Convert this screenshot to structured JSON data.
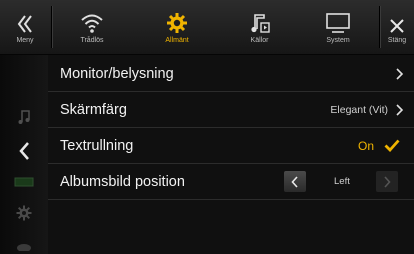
{
  "topbar": {
    "menu_label": "Meny",
    "tabs": [
      {
        "label": "Trådlös",
        "icon": "wifi-icon"
      },
      {
        "label": "Allmänt",
        "icon": "gear-icon"
      },
      {
        "label": "Källor",
        "icon": "music-note-icon"
      },
      {
        "label": "System",
        "icon": "monitor-icon"
      }
    ],
    "close_label": "Stäng",
    "active_tab": "Allmänt",
    "accent_color": "#f0b400"
  },
  "settings": [
    {
      "label": "Monitor/belysning"
    },
    {
      "label": "Skärmfärg",
      "value": "Elegant (Vit)"
    },
    {
      "label": "Textrullning",
      "value": "On"
    },
    {
      "label": "Albumsbild position",
      "value": "Left"
    }
  ]
}
